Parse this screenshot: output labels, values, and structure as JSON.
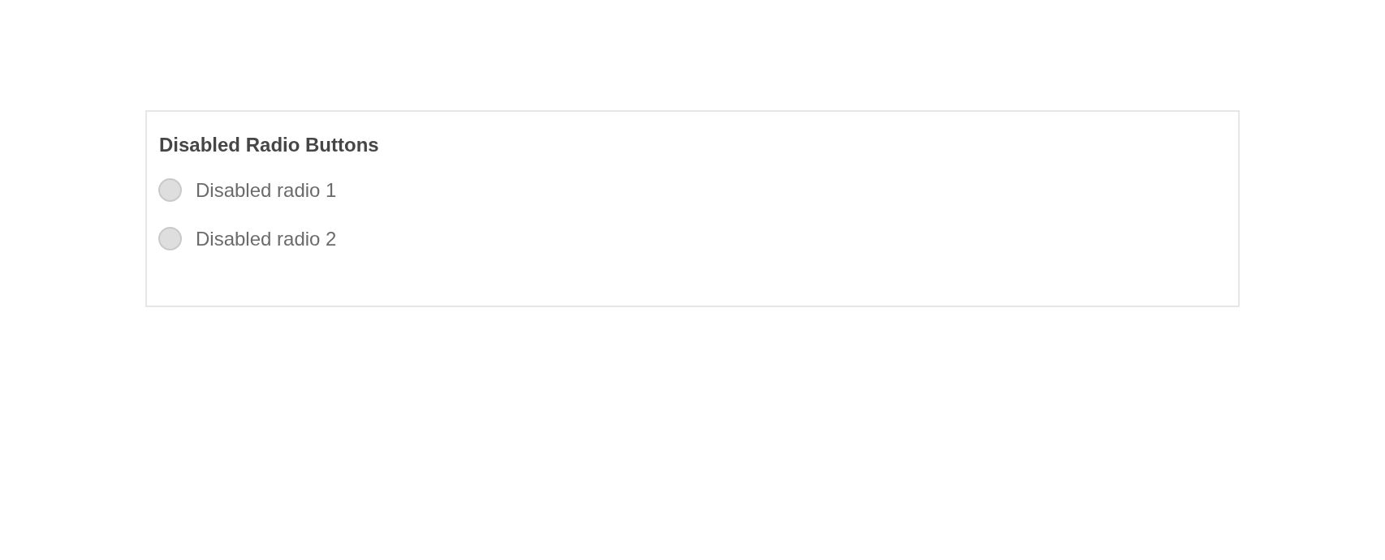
{
  "card": {
    "title": "Disabled Radio Buttons",
    "radios": [
      {
        "label": "Disabled radio 1",
        "selected": false,
        "disabled": true
      },
      {
        "label": "Disabled radio 2",
        "selected": false,
        "disabled": true
      }
    ]
  }
}
